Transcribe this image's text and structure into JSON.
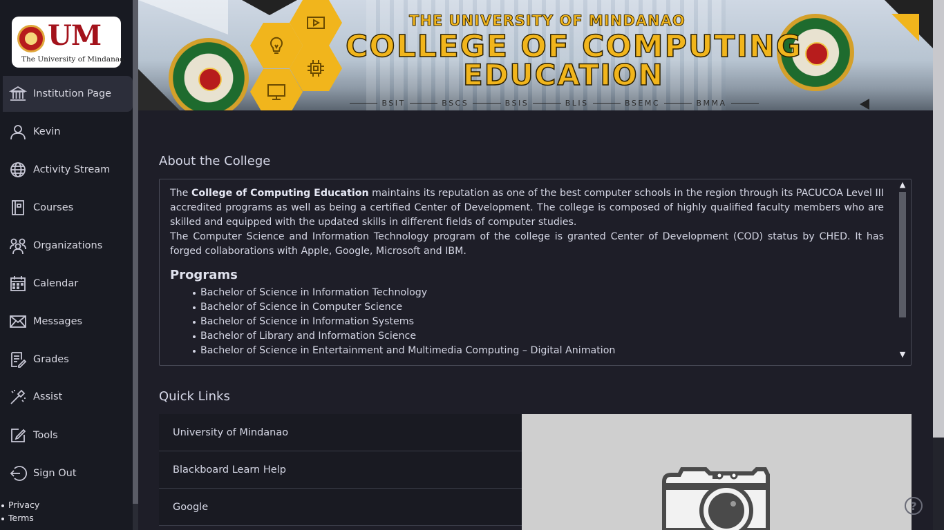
{
  "logo": {
    "mark": "UM",
    "subtitle": "The University of Mindanao"
  },
  "nav": {
    "items": [
      {
        "label": "Institution Page",
        "icon": "institution-icon"
      },
      {
        "label": "Kevin",
        "icon": "user-icon"
      },
      {
        "label": "Activity Stream",
        "icon": "globe-icon"
      },
      {
        "label": "Courses",
        "icon": "book-icon"
      },
      {
        "label": "Organizations",
        "icon": "group-icon"
      },
      {
        "label": "Calendar",
        "icon": "calendar-icon"
      },
      {
        "label": "Messages",
        "icon": "envelope-icon"
      },
      {
        "label": "Grades",
        "icon": "grades-icon"
      },
      {
        "label": "Assist",
        "icon": "assist-icon"
      },
      {
        "label": "Tools",
        "icon": "tools-icon"
      },
      {
        "label": "Sign Out",
        "icon": "sign-out-icon"
      }
    ],
    "active_index": 0
  },
  "footer_links": {
    "privacy": "Privacy",
    "terms": "Terms"
  },
  "banner": {
    "top_line": "THE UNIVERSITY OF MINDANAO",
    "main_line1": "COLLEGE OF COMPUTING",
    "main_line2": "EDUCATION",
    "programs": [
      "BSIT",
      "BSCS",
      "BSIS",
      "BLIS",
      "BSEMC",
      "BMMA"
    ],
    "seal_text": "COLLEGE OF COMPUTING EDUCATION",
    "accent_color": "#f1b51c",
    "seal_color": "#1e6b2e"
  },
  "about": {
    "title": "About the College",
    "p1_lead": "The ",
    "p1_bold": "College of Computing Education",
    "p1_rest": " maintains its reputation as one of the best computer schools in the region through its PACUCOA Level III accredited programs as well as being a certified Center of Development. The college is composed of highly qualified faculty members who are skilled and equipped with the updated skills in different fields of computer studies.",
    "p2": "The Computer Science and Information Technology program of the college is granted Center of Development (COD) status by CHED. It has forged collaborations with Apple, Google, Microsoft and IBM.",
    "programs_title": "Programs",
    "programs": [
      "Bachelor of Science in Information Technology",
      "Bachelor of Science in Computer Science",
      "Bachelor of Science in Information Systems",
      "Bachelor of Library and Information Science",
      "Bachelor of Science in Entertainment and Multimedia Computing – Digital Animation"
    ]
  },
  "quick_links": {
    "title": "Quick Links",
    "items": [
      "University of Mindanao",
      "Blackboard Learn Help",
      "Google"
    ]
  },
  "help": {
    "glyph": "?"
  }
}
